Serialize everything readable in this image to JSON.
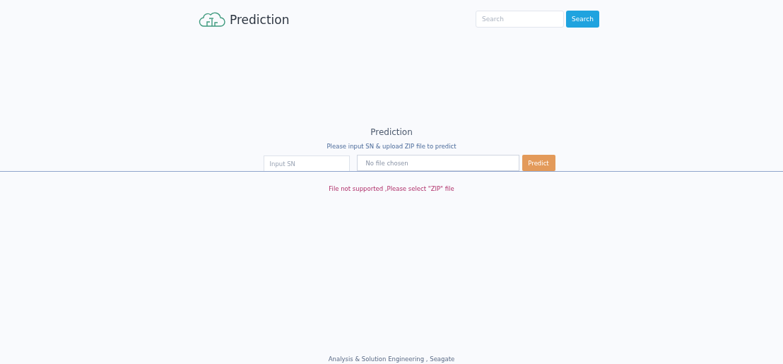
{
  "header": {
    "brand": "Prediction",
    "search": {
      "placeholder": "Search"
    },
    "search_button": "Search"
  },
  "form": {
    "title": "Prediction",
    "subtitle": "Please input SN & upload ZIP file to predict",
    "sn_field": {
      "placeholder": "Input SN"
    },
    "file_field": {
      "value": "No file chosen"
    },
    "predict_button": "Predict",
    "error": "File not supported ,Please select \"ZIP\" file"
  },
  "footer": "Analysis & Solution Engineering , Seagate"
}
